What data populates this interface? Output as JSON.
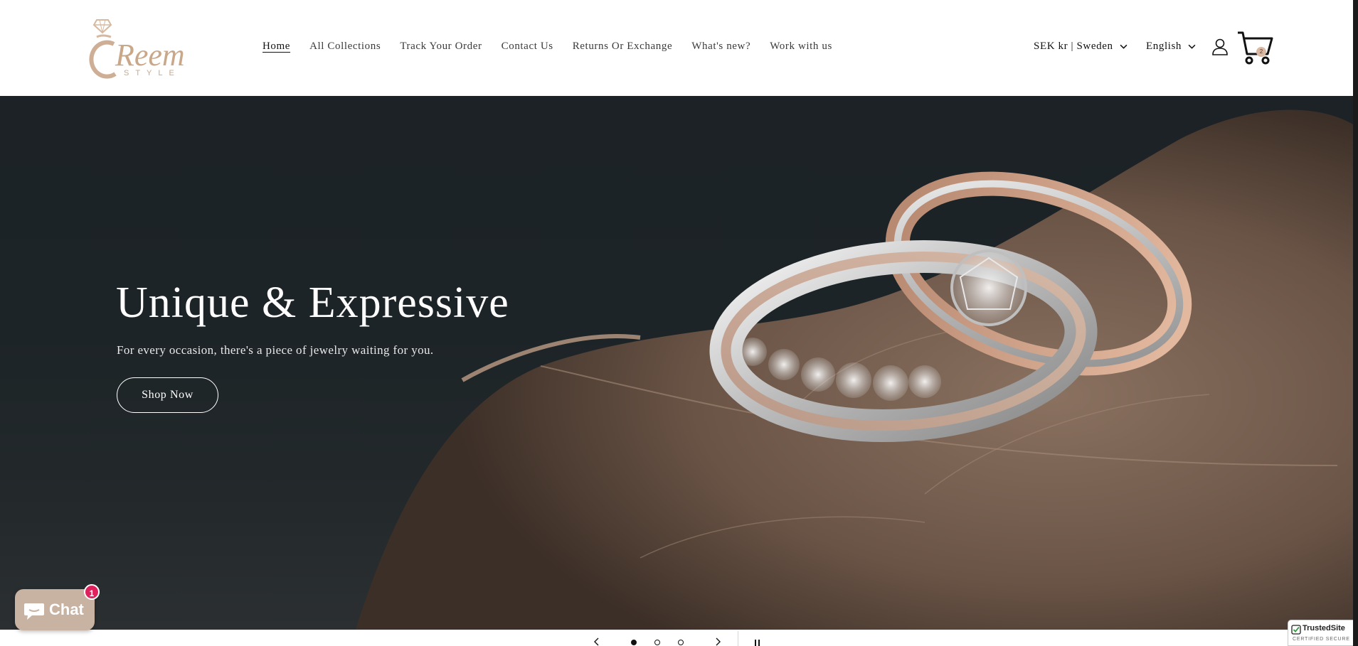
{
  "brand": {
    "logo_name": "Reem",
    "logo_tagline": "STYLE"
  },
  "nav": {
    "items": [
      {
        "label": "Home",
        "active": true
      },
      {
        "label": "All Collections",
        "active": false
      },
      {
        "label": "Track Your Order",
        "active": false
      },
      {
        "label": "Contact Us",
        "active": false
      },
      {
        "label": "Returns Or Exchange",
        "active": false
      },
      {
        "label": "What's new?",
        "active": false
      },
      {
        "label": "Work with us",
        "active": false
      }
    ]
  },
  "locale": {
    "currency_country": "SEK kr | Sweden",
    "language": "English"
  },
  "header_icons": {
    "account": "account-icon",
    "cart": "cart-icon",
    "cart_count": "2"
  },
  "hero": {
    "title": "Unique & Expressive",
    "subtitle": "For every occasion, there's a piece of jewelry waiting for you.",
    "cta_label": "Shop Now"
  },
  "slider": {
    "slide_count": 3,
    "active_index": 0,
    "prev_icon": "chevron-left-icon",
    "next_icon": "chevron-right-icon",
    "pause_icon": "pause-icon"
  },
  "chat": {
    "label": "Chat",
    "badge": "1"
  },
  "trust_badge": {
    "name": "TrustedSite",
    "subtitle": "CERTIFIED SECURE"
  },
  "colors": {
    "accent_logo": "#c9a88a",
    "chat_bg": "#c8b3a2",
    "badge_red": "#e0205c",
    "hero_bg": "#1d2427"
  }
}
